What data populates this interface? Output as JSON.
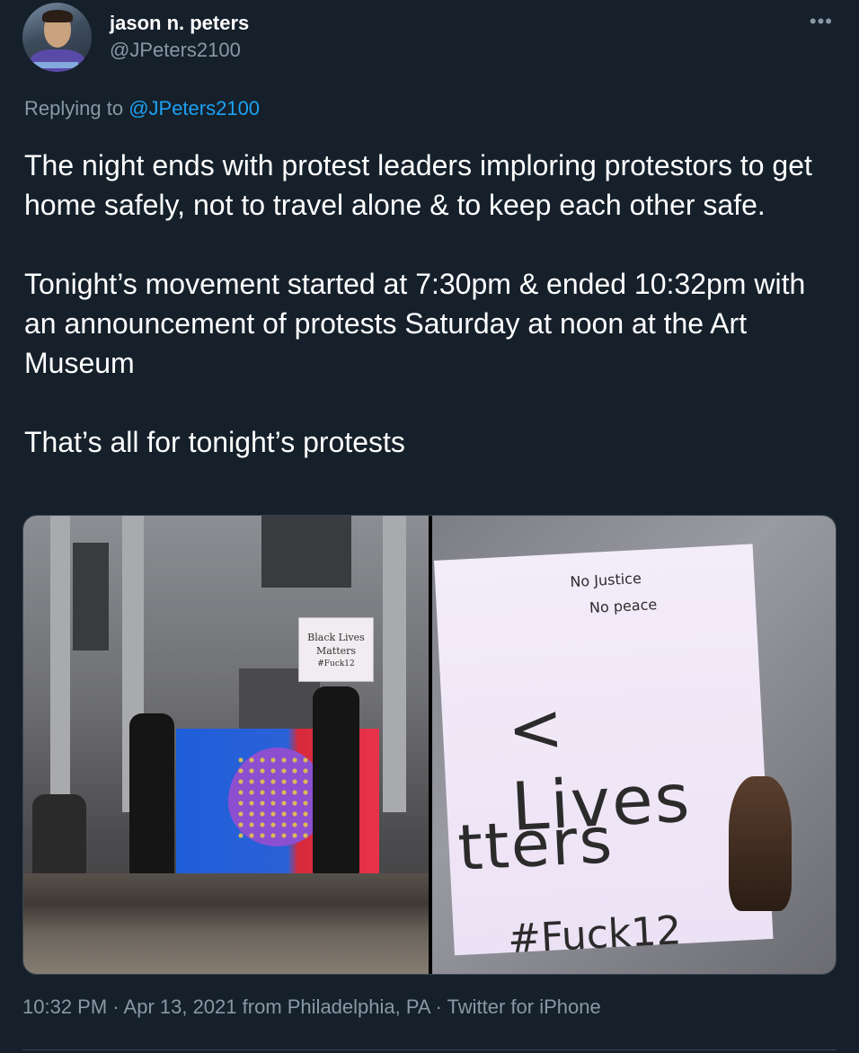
{
  "author": {
    "name": "jason n. peters",
    "handle": "@JPeters2100"
  },
  "more_icon": "more-horizontal-icon",
  "reply": {
    "prefix": "Replying to ",
    "mention": "@JPeters2100"
  },
  "tweet": {
    "paragraphs": [
      "The night ends with protest leaders imploring protestors to get home safely, not to travel alone & to keep each other safe.",
      "Tonight’s movement started at 7:30pm & ended 10:32pm with an announcement of protests Saturday at noon at the Art Museum",
      "That’s all for tonight’s protests"
    ]
  },
  "media": {
    "left_sign": [
      "No justice",
      "no peace",
      "Black Lives",
      "Matters",
      "#Fuck12"
    ],
    "right_sign": {
      "top1": "No Justice",
      "top2": "No peace",
      "line1": "< Lives",
      "line2": "tters",
      "line3": "#Fuck12"
    }
  },
  "meta": {
    "time": "10:32 PM",
    "date": "Apr 13, 2021",
    "location": "from Philadelphia, PA",
    "source": "Twitter for iPhone"
  },
  "colors": {
    "background": "#15202b",
    "secondary_text": "#8899a6",
    "link": "#1da1f2",
    "border": "#38444d"
  }
}
